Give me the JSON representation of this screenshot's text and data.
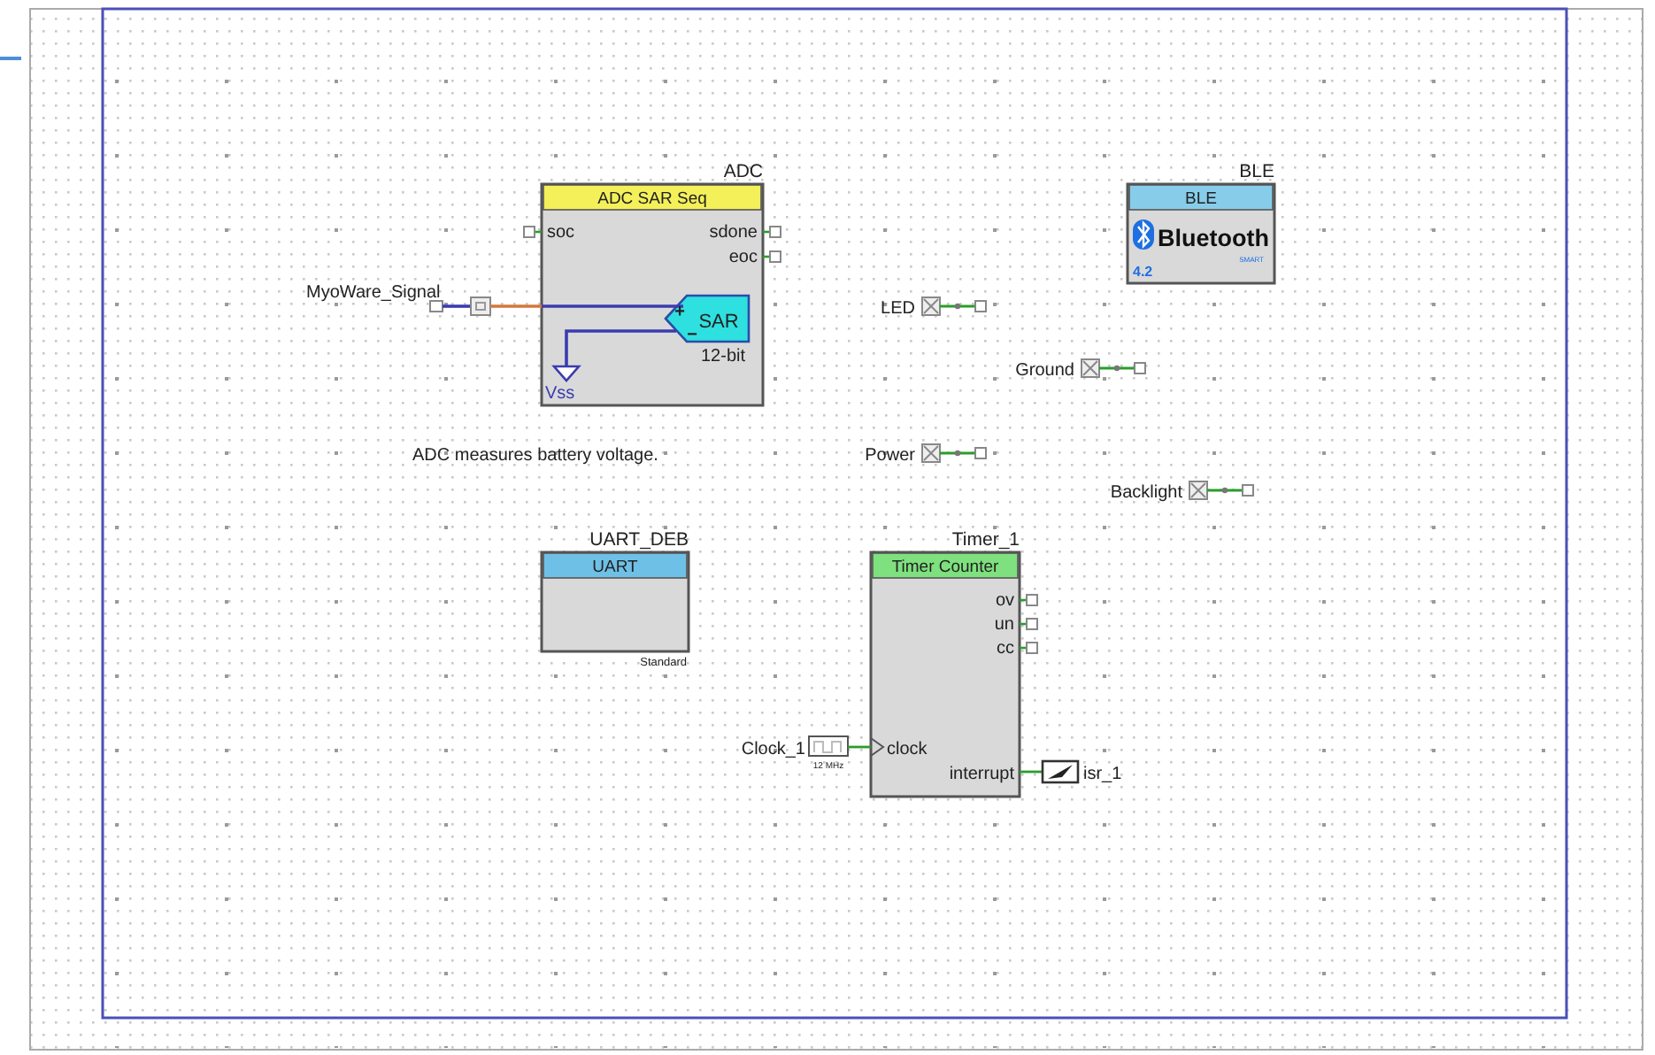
{
  "schematic": {
    "components": [
      {
        "kind": "adc",
        "instance": "ADC",
        "title": "ADC SAR Seq",
        "left_pins": [
          "soc"
        ],
        "right_pins": [
          "sdone",
          "eoc"
        ],
        "amplifier": "SAR",
        "inputs": [
          "+",
          "−"
        ],
        "resolution": "12-bit",
        "ground": "Vss"
      },
      {
        "kind": "ble",
        "instance": "BLE",
        "title": "BLE",
        "logo": "Bluetooth",
        "logo_subtitle": "SMART",
        "version": "4.2"
      },
      {
        "kind": "uart",
        "instance": "UART_DEB",
        "title": "UART",
        "mode": "Standard"
      },
      {
        "kind": "timer",
        "instance": "Timer_1",
        "title": "Timer Counter",
        "right_pins": [
          "ov",
          "un",
          "cc"
        ],
        "clock_pin": "clock",
        "interrupt_pin": "interrupt"
      }
    ],
    "analog_pins": [
      {
        "label": "MyoWare_Signal"
      }
    ],
    "digital_ports": [
      {
        "label": "LED"
      },
      {
        "label": "Ground"
      },
      {
        "label": "Power"
      },
      {
        "label": "Backlight"
      }
    ],
    "clocks": [
      {
        "label": "Clock_1",
        "frequency": "12 MHz"
      }
    ],
    "interrupts": [
      {
        "label": "isr_1"
      }
    ],
    "notes": [
      "ADC measures battery voltage."
    ]
  }
}
